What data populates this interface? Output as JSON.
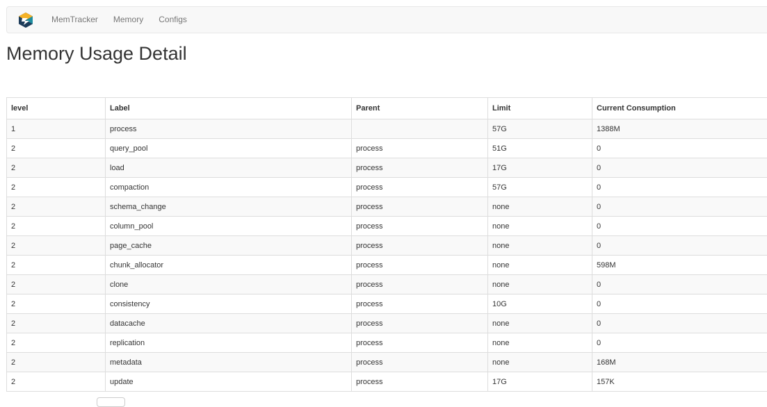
{
  "nav": {
    "brand_icon": "starrocks-logo-icon",
    "links": [
      {
        "label": "MemTracker"
      },
      {
        "label": "Memory"
      },
      {
        "label": "Configs"
      }
    ]
  },
  "page": {
    "title": "Memory Usage Detail"
  },
  "table": {
    "headers": {
      "level": "level",
      "label": "Label",
      "parent": "Parent",
      "limit": "Limit",
      "current": "Current Consumption"
    },
    "rows": [
      {
        "level": "1",
        "label": "process",
        "parent": "",
        "limit": "57G",
        "current": "1388M"
      },
      {
        "level": "2",
        "label": "query_pool",
        "parent": "process",
        "limit": "51G",
        "current": "0"
      },
      {
        "level": "2",
        "label": "load",
        "parent": "process",
        "limit": "17G",
        "current": "0"
      },
      {
        "level": "2",
        "label": "compaction",
        "parent": "process",
        "limit": "57G",
        "current": "0"
      },
      {
        "level": "2",
        "label": "schema_change",
        "parent": "process",
        "limit": "none",
        "current": "0"
      },
      {
        "level": "2",
        "label": "column_pool",
        "parent": "process",
        "limit": "none",
        "current": "0"
      },
      {
        "level": "2",
        "label": "page_cache",
        "parent": "process",
        "limit": "none",
        "current": "0"
      },
      {
        "level": "2",
        "label": "chunk_allocator",
        "parent": "process",
        "limit": "none",
        "current": "598M"
      },
      {
        "level": "2",
        "label": "clone",
        "parent": "process",
        "limit": "none",
        "current": "0"
      },
      {
        "level": "2",
        "label": "consistency",
        "parent": "process",
        "limit": "10G",
        "current": "0"
      },
      {
        "level": "2",
        "label": "datacache",
        "parent": "process",
        "limit": "none",
        "current": "0"
      },
      {
        "level": "2",
        "label": "replication",
        "parent": "process",
        "limit": "none",
        "current": "0"
      },
      {
        "level": "2",
        "label": "metadata",
        "parent": "process",
        "limit": "none",
        "current": "168M"
      },
      {
        "level": "2",
        "label": "update",
        "parent": "process",
        "limit": "17G",
        "current": "157K"
      }
    ]
  },
  "colors": {
    "logo_yellow": "#f5b226",
    "logo_teal": "#1f8ea0",
    "logo_navy": "#1d3c5a"
  }
}
